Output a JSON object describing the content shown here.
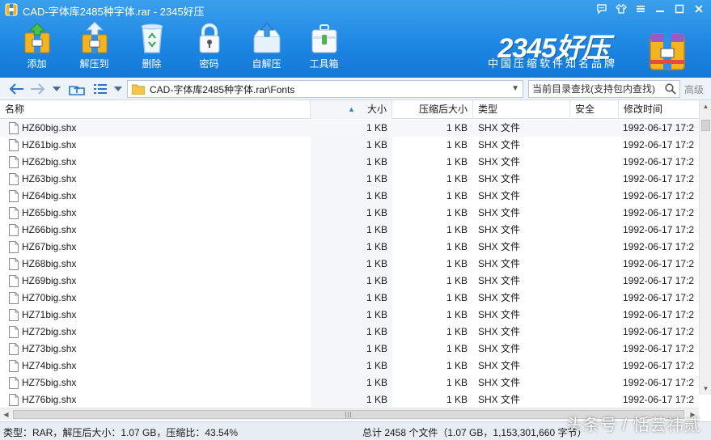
{
  "window": {
    "title": "CAD-字体库2485种字体.rar - 2345好压"
  },
  "toolbar": {
    "items": [
      {
        "label": "添加",
        "icon": "add-archive-icon"
      },
      {
        "label": "解压到",
        "icon": "extract-to-icon"
      },
      {
        "label": "删除",
        "icon": "recycle-delete-icon"
      },
      {
        "label": "密码",
        "icon": "lock-password-icon"
      },
      {
        "label": "自解压",
        "icon": "self-extract-icon"
      },
      {
        "label": "工具箱",
        "icon": "toolbox-icon"
      }
    ]
  },
  "brand": {
    "name": "2345好压",
    "slogan": "中国压缩软件知名品牌"
  },
  "address": {
    "path": "CAD-字体库2485种字体.rar\\Fonts",
    "search_placeholder": "当前目录查找(支持包内查找)",
    "advanced_label": "高级"
  },
  "columns": {
    "name": "名称",
    "size": "大小",
    "compressed": "压缩后大小",
    "type": "类型",
    "security": "安全",
    "modified": "修改时间"
  },
  "files": [
    {
      "name": "HZ60big.shx",
      "size": "1 KB",
      "compressed": "1 KB",
      "type": "SHX 文件",
      "security": "",
      "modified": "1992-06-17 17:2"
    },
    {
      "name": "HZ61big.shx",
      "size": "1 KB",
      "compressed": "1 KB",
      "type": "SHX 文件",
      "security": "",
      "modified": "1992-06-17 17:2"
    },
    {
      "name": "HZ62big.shx",
      "size": "1 KB",
      "compressed": "1 KB",
      "type": "SHX 文件",
      "security": "",
      "modified": "1992-06-17 17:2"
    },
    {
      "name": "HZ63big.shx",
      "size": "1 KB",
      "compressed": "1 KB",
      "type": "SHX 文件",
      "security": "",
      "modified": "1992-06-17 17:2"
    },
    {
      "name": "HZ64big.shx",
      "size": "1 KB",
      "compressed": "1 KB",
      "type": "SHX 文件",
      "security": "",
      "modified": "1992-06-17 17:2"
    },
    {
      "name": "HZ65big.shx",
      "size": "1 KB",
      "compressed": "1 KB",
      "type": "SHX 文件",
      "security": "",
      "modified": "1992-06-17 17:2"
    },
    {
      "name": "HZ66big.shx",
      "size": "1 KB",
      "compressed": "1 KB",
      "type": "SHX 文件",
      "security": "",
      "modified": "1992-06-17 17:2"
    },
    {
      "name": "HZ67big.shx",
      "size": "1 KB",
      "compressed": "1 KB",
      "type": "SHX 文件",
      "security": "",
      "modified": "1992-06-17 17:2"
    },
    {
      "name": "HZ68big.shx",
      "size": "1 KB",
      "compressed": "1 KB",
      "type": "SHX 文件",
      "security": "",
      "modified": "1992-06-17 17:2"
    },
    {
      "name": "HZ69big.shx",
      "size": "1 KB",
      "compressed": "1 KB",
      "type": "SHX 文件",
      "security": "",
      "modified": "1992-06-17 17:2"
    },
    {
      "name": "HZ70big.shx",
      "size": "1 KB",
      "compressed": "1 KB",
      "type": "SHX 文件",
      "security": "",
      "modified": "1992-06-17 17:2"
    },
    {
      "name": "HZ71big.shx",
      "size": "1 KB",
      "compressed": "1 KB",
      "type": "SHX 文件",
      "security": "",
      "modified": "1992-06-17 17:2"
    },
    {
      "name": "HZ72big.shx",
      "size": "1 KB",
      "compressed": "1 KB",
      "type": "SHX 文件",
      "security": "",
      "modified": "1992-06-17 17:2"
    },
    {
      "name": "HZ73big.shx",
      "size": "1 KB",
      "compressed": "1 KB",
      "type": "SHX 文件",
      "security": "",
      "modified": "1992-06-17 17:2"
    },
    {
      "name": "HZ74big.shx",
      "size": "1 KB",
      "compressed": "1 KB",
      "type": "SHX 文件",
      "security": "",
      "modified": "1992-06-17 17:2"
    },
    {
      "name": "HZ75big.shx",
      "size": "1 KB",
      "compressed": "1 KB",
      "type": "SHX 文件",
      "security": "",
      "modified": "1992-06-17 17:2"
    },
    {
      "name": "HZ76big.shx",
      "size": "1 KB",
      "compressed": "1 KB",
      "type": "SHX 文件",
      "security": "",
      "modified": "1992-06-17 17:2"
    }
  ],
  "status": {
    "left": "类型：RAR，解压后大小：1.07 GB，压缩比：43.54%",
    "right": "总计 2458 个文件（1.07 GB，1,153,301,660 字节）"
  },
  "watermark": "头条号 / 恬芸祎贰",
  "colors": {
    "header_blue": "#1d86e2",
    "address_bg": "#eef3f9",
    "status_bg": "#e8edf3",
    "accent": "#2a74c4"
  }
}
